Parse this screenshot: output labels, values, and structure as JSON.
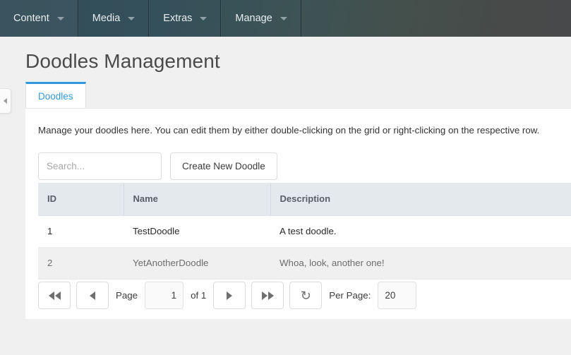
{
  "navbar": {
    "items": [
      {
        "label": "Content",
        "icon": "chevron-down-icon"
      },
      {
        "label": "Media",
        "icon": "chevron-down-icon"
      },
      {
        "label": "Extras",
        "icon": "chevron-down-icon"
      },
      {
        "label": "Manage",
        "icon": "chevron-down-icon"
      }
    ],
    "colors": {
      "start": "#324d58",
      "mid": "#3d5355",
      "end": "#48494a"
    }
  },
  "page": {
    "title": "Doodles Management"
  },
  "tabs": [
    {
      "label": "Doodles",
      "active": true,
      "accent": "#3498db"
    }
  ],
  "panel": {
    "description": "Manage your doodles here. You can edit them by either double-clicking on the grid or right-clicking on the respective row."
  },
  "toolbar": {
    "search_placeholder": "Search...",
    "search_value": "",
    "create_label": "Create New Doodle"
  },
  "grid": {
    "columns": [
      "ID",
      "Name",
      "Description"
    ],
    "rows": [
      {
        "id": "1",
        "name": "TestDoodle",
        "description": "A test doodle."
      },
      {
        "id": "2",
        "name": "YetAnotherDoodle",
        "description": "Whoa, look, another one!"
      }
    ]
  },
  "pager": {
    "first_icon": "double-chevron-left-icon",
    "prev_icon": "chevron-left-icon",
    "page_label": "Page",
    "page_value": "1",
    "of_label": "of 1",
    "next_icon": "chevron-right-icon",
    "last_icon": "double-chevron-right-icon",
    "refresh_icon": "refresh-icon",
    "refresh_glyph": "↻",
    "per_page_label": "Per Page:",
    "per_page_value": "20"
  },
  "sidebar_handle": {
    "icon": "chevron-left-icon"
  }
}
